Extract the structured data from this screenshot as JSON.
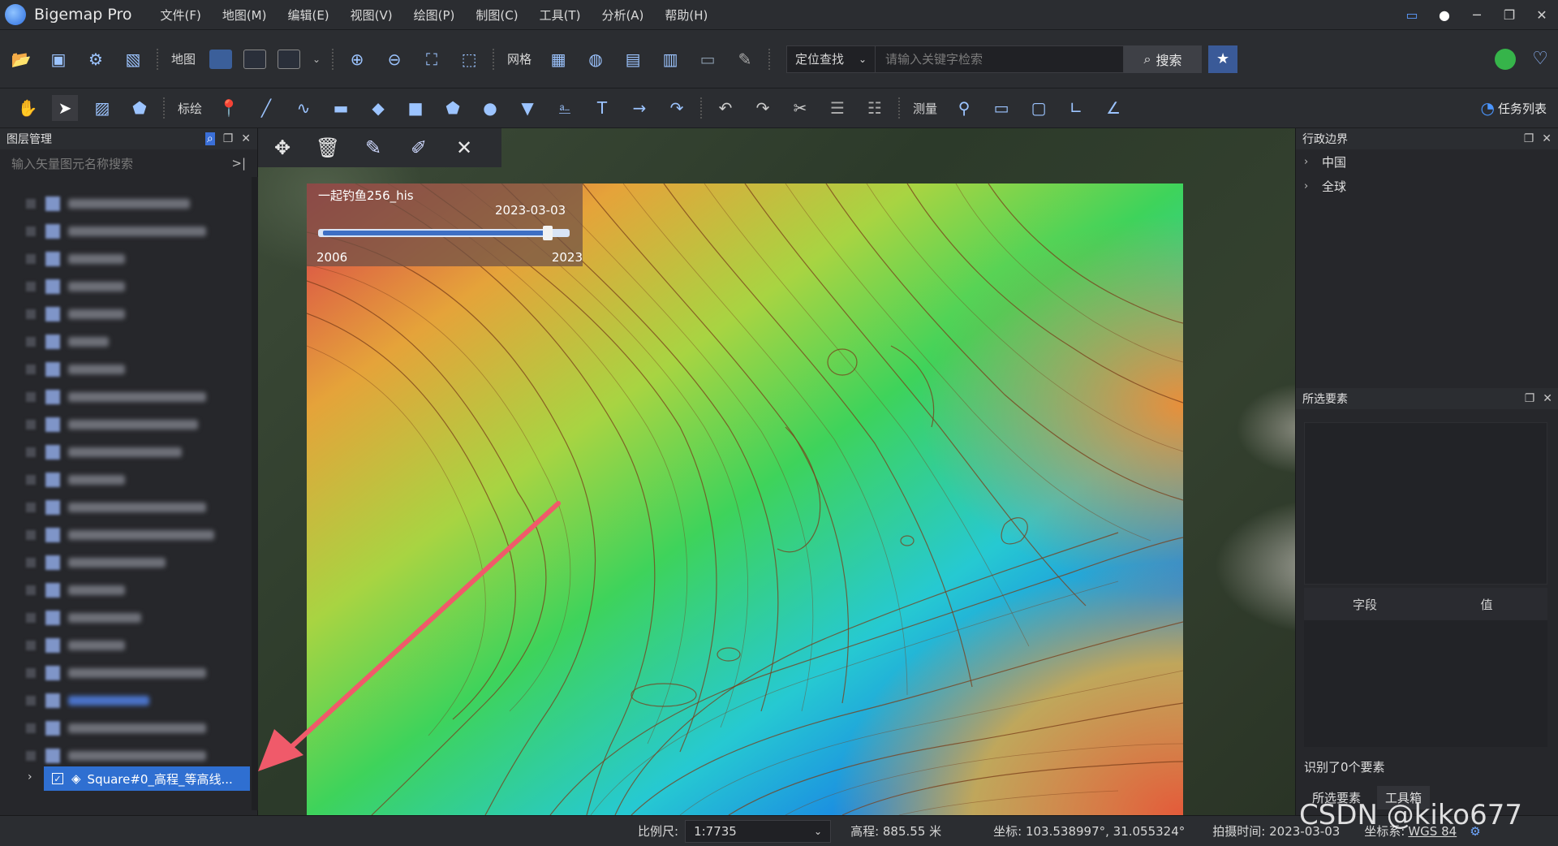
{
  "app": {
    "title": "Bigemap Pro"
  },
  "menu": [
    "文件(F)",
    "地图(M)",
    "编辑(E)",
    "视图(V)",
    "绘图(P)",
    "制图(C)",
    "工具(T)",
    "分析(A)",
    "帮助(H)"
  ],
  "toolbar1": {
    "map_label": "地图",
    "grid_label": "网格",
    "locate_select": "定位查找",
    "search_placeholder": "请输入关键字检索",
    "search_button": "搜索"
  },
  "toolbar2": {
    "annotate_label": "标绘",
    "measure_label": "测量",
    "task_list": "任务列表"
  },
  "left_panel": {
    "title": "图层管理",
    "search_placeholder": "输入矢量图元名称搜索",
    "selected_layer": "Square#0_高程_等高线..."
  },
  "timeline": {
    "title": "一起钓鱼256_his",
    "date": "2023-03-03",
    "start_year": "2006",
    "end_year": "2023",
    "position": 0.95
  },
  "right_panel": {
    "admin_title": "行政边界",
    "admin_items": [
      "中国",
      "全球"
    ],
    "selected_title": "所选要素",
    "field_header": "字段",
    "value_header": "值",
    "count_text": "识别了0个要素",
    "tabs": [
      "所选要素",
      "工具箱"
    ]
  },
  "status": {
    "scale_label": "比例尺:",
    "scale_value": "1:7735",
    "elevation": "高程: 885.55 米",
    "coords": "坐标: 103.538997°, 31.055324°",
    "capture_time": "拍摄时间: 2023-03-03",
    "crs_label": "坐标系:",
    "crs_value": "WGS 84"
  },
  "watermark": "CSDN @kiko677"
}
